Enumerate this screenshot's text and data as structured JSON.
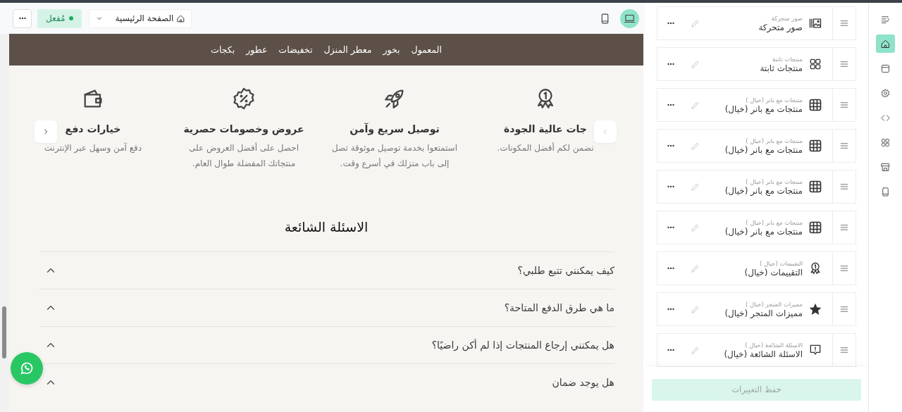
{
  "toolbar": {
    "devices": [
      {
        "kind": "laptop",
        "selected": true
      },
      {
        "kind": "tablet",
        "selected": false
      }
    ],
    "page_select": {
      "value": "الصفحة الرئيسية"
    },
    "status_badge": {
      "label": "مُفعل",
      "on": true
    }
  },
  "store_preview": {
    "nav_menu": [
      "المعمول",
      "بخور",
      "معطر المنزل",
      "تخفيضات",
      "عطور",
      "بكجات"
    ],
    "features": [
      {
        "kind": "medal",
        "title": "جات عالية الجودة",
        "text": "نضمن لكم أفضل المكونات."
      },
      {
        "kind": "rocket",
        "title": "توصيل سريع وآمن",
        "text": "استمتعوا بخدمة توصيل موثوقة تصل إلى باب منزلك في أسرع وقت."
      },
      {
        "kind": "discount",
        "title": "عروض وخصومات حصرية",
        "text": "احصل على أفضل العروض على منتجاتك المفضلة طوال العام."
      },
      {
        "kind": "wallet",
        "title": "خيارات دفع",
        "text": "دفع آمن وسهل عبر الإنترنت"
      }
    ],
    "faq": {
      "title": "الاسئلة الشائعة",
      "questions": [
        "كيف يمكنني تتبع طلبي؟",
        "ما هي طرق الدفع المتاحة؟",
        "هل يمكنني إرجاع المنتجات إذا لم أكن راضيًا؟",
        "هل يوجد ضمان"
      ]
    }
  },
  "sections": [
    {
      "kind": "slider",
      "subtitle": "صور متحركة",
      "title": "صور متحركة"
    },
    {
      "kind": "grid",
      "subtitle": "منتجات ثابتة",
      "title": "منتجات ثابتة"
    },
    {
      "kind": "table",
      "subtitle": "منتجات مع بانر (خيال )",
      "title": "منتجات مع بانر (خيال)"
    },
    {
      "kind": "table",
      "subtitle": "منتجات مع بانر (خيال )",
      "title": "منتجات مع بانر (خيال)"
    },
    {
      "kind": "table",
      "subtitle": "منتجات مع بانر (خيال )",
      "title": "منتجات مع بانر (خيال)"
    },
    {
      "kind": "table",
      "subtitle": "منتجات مع بانر (خيال )",
      "title": "منتجات مع بانر (خيال)"
    },
    {
      "kind": "medal",
      "subtitle": "التقييمات (خيال )",
      "title": "التقييمات (خيال)"
    },
    {
      "kind": "star",
      "subtitle": "مميزات المتجر (خيال )",
      "title": "مميزات المتجر (خيال)"
    },
    {
      "kind": "faq",
      "subtitle": "الاسئلة الشائعة (خيال )",
      "title": "الاسئلة الشائعة (خيال)"
    }
  ],
  "save_button": {
    "label": "حفظ التغييرات",
    "disabled": true
  },
  "rail": [
    {
      "kind": "collapse",
      "selected": false
    },
    {
      "kind": "home",
      "selected": true
    },
    {
      "kind": "layout",
      "selected": false
    },
    {
      "kind": "settings",
      "selected": false
    },
    {
      "kind": "code",
      "selected": false
    },
    {
      "kind": "grid",
      "selected": false
    },
    {
      "kind": "store",
      "selected": false
    },
    {
      "kind": "tablet",
      "selected": false
    }
  ]
}
